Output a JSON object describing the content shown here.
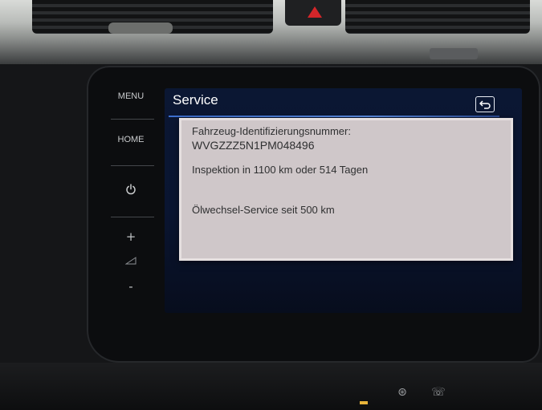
{
  "hardware_buttons": {
    "menu": "MENU",
    "home": "HOME",
    "power_icon": "power-icon",
    "volume_up": "+",
    "volume_down": "-"
  },
  "screen": {
    "title": "Service",
    "back_icon": "back-arrow-icon",
    "accent_color": "#3c6fd0",
    "background_color": "#0b1733"
  },
  "dialog": {
    "vin_label": "Fahrzeug-Identifizierungsnummer:",
    "vin_value": "WVGZZZ5N1PM048496",
    "inspection": "Inspektion in 1100 km oder 514 Tagen",
    "oil_service": "Ölwechsel-Service seit 500 km"
  },
  "dashboard": {
    "hazard_color": "#d4262a"
  }
}
